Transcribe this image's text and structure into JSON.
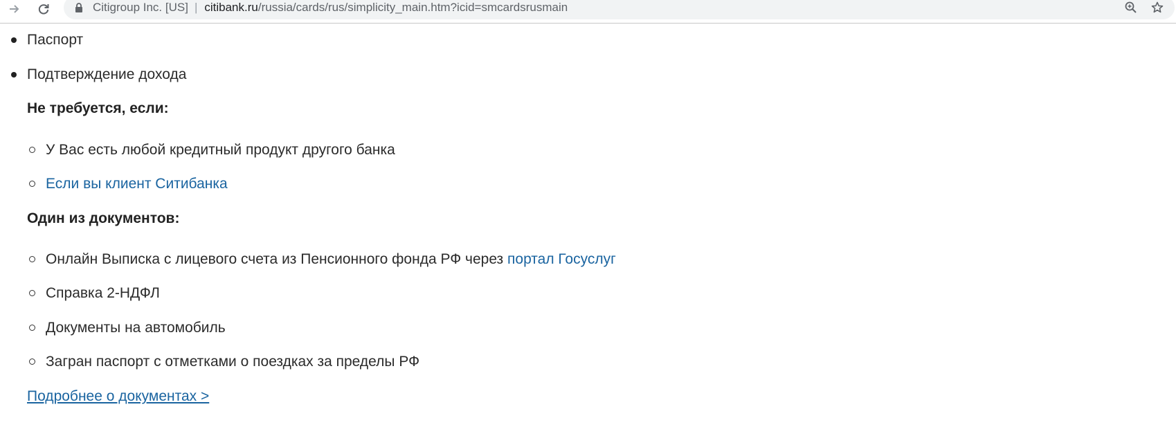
{
  "browser": {
    "org_name": "Citigroup Inc. [US]",
    "url_separator": "|",
    "url_host": "citibank.ru",
    "url_path": "/russia/cards/rus/simplicity_main.htm?icid=smcardsrusmain",
    "icons": [
      "forward-arrow-icon",
      "reload-icon",
      "lock-icon",
      "zoom-icon",
      "star-icon"
    ]
  },
  "content": {
    "top_items": [
      "Паспорт",
      "Подтверждение дохода"
    ],
    "not_required_heading": "Не требуется, если:",
    "not_required_items": [
      "У Вас есть любой кредитный продукт другого банка",
      "Если вы клиент Ситибанка"
    ],
    "one_of_heading": "Один из документов:",
    "one_of_items": {
      "pension_text": "Онлайн Выписка с лицевого счета из Пенсионного фонда РФ через ",
      "pension_link": "портал Госуслуг",
      "item2": "Справка 2-НДФЛ",
      "item3": "Документы на автомобиль",
      "item4": "Загран паспорт с отметками о поездках за пределы РФ"
    },
    "more_link": "Подробнее о документах >"
  },
  "colors": {
    "link": "#1a64a0",
    "text": "#2b2b2b",
    "omnibox_bg": "#f1f3f4"
  }
}
